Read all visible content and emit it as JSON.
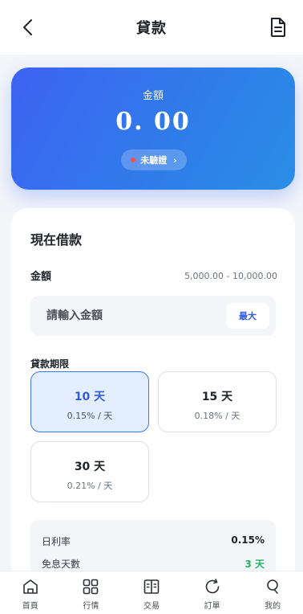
{
  "header": {
    "title": "貸款"
  },
  "amount_card": {
    "label": "金額",
    "value": "0. 00",
    "badge": "未驗證",
    "badge_arrow": "›"
  },
  "borrow": {
    "title": "現在借款",
    "amount_label": "金額",
    "range": "5,000.00 - 10,000.00",
    "input_placeholder": "請輸入金額",
    "input_value": "",
    "max_label": "最大",
    "term_label": "貸款期限",
    "terms": [
      {
        "days": "10 天",
        "rate": "0.15% / 天",
        "selected": true
      },
      {
        "days": "15 天",
        "rate": "0.18% / 天",
        "selected": false
      },
      {
        "days": "30 天",
        "rate": "0.21% / 天",
        "selected": false
      }
    ],
    "summary": {
      "daily_rate_label": "日利率",
      "daily_rate_value": "0.15%",
      "free_days_label": "免息天數",
      "free_days_value": "3 天"
    }
  },
  "nav": [
    {
      "label": "首頁",
      "icon": "home-icon"
    },
    {
      "label": "行情",
      "icon": "grid-icon"
    },
    {
      "label": "交易",
      "icon": "book-icon"
    },
    {
      "label": "訂單",
      "icon": "refresh-icon"
    },
    {
      "label": "我的",
      "icon": "user-icon"
    }
  ],
  "colors": {
    "accent": "#2f5be3",
    "card_gradient_start": "#3d63f3",
    "card_gradient_end": "#2a8ee6",
    "badge_dot": "#ff4d3d",
    "positive": "#1fb664"
  }
}
